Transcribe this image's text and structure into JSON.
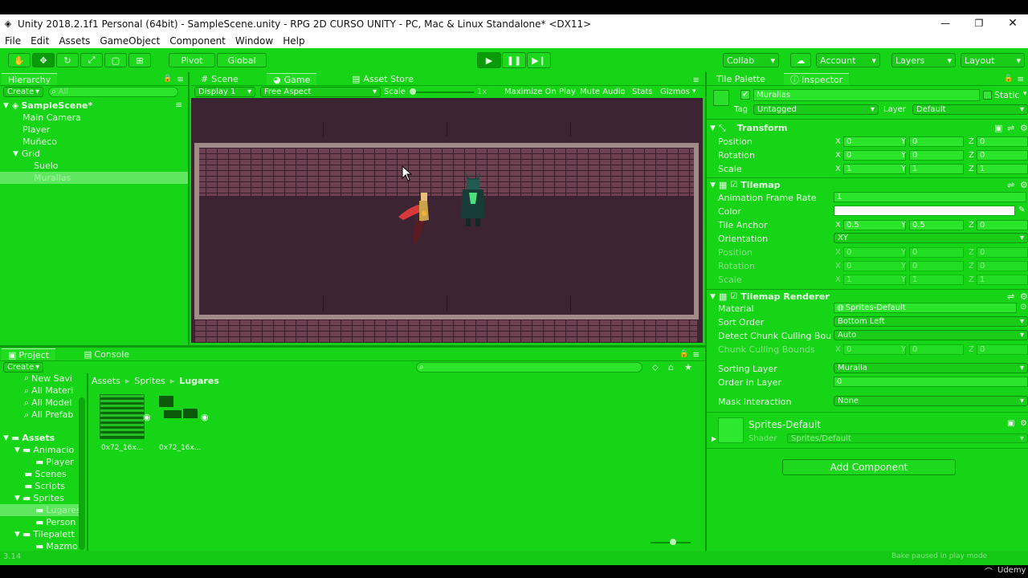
{
  "window": {
    "title": "Unity 2018.2.1f1 Personal (64bit) - SampleScene.unity - RPG 2D CURSO UNITY - PC, Mac & Linux Standalone* <DX11>"
  },
  "menu": [
    "File",
    "Edit",
    "Assets",
    "GameObject",
    "Component",
    "Window",
    "Help"
  ],
  "toolbar": {
    "pivot": "Pivot",
    "global": "Global",
    "collab": "Collab",
    "account": "Account",
    "layers": "Layers",
    "layout": "Layout"
  },
  "hierarchy": {
    "tab": "Hierarchy",
    "create": "Create",
    "search_placeholder": "All",
    "scene": "SampleScene*",
    "items": [
      "Main Camera",
      "Player",
      "Muñeco",
      "Grid",
      "Suelo",
      "Murallas"
    ]
  },
  "center_tabs": {
    "scene": "Scene",
    "game": "Game",
    "store": "Asset Store"
  },
  "game_bar": {
    "display": "Display 1",
    "aspect": "Free Aspect",
    "scale": "Scale",
    "scale_value": "1x",
    "maximize": "Maximize On Play",
    "mute": "Mute Audio",
    "stats": "Stats",
    "gizmos": "Gizmos"
  },
  "inspector": {
    "tab_palette": "Tile Palette",
    "tab": "Inspector",
    "object_name": "Murallas",
    "static": "Static",
    "tag_label": "Tag",
    "tag_value": "Untagged",
    "layer_label": "Layer",
    "layer_value": "Default",
    "transform": {
      "title": "Transform",
      "position_label": "Position",
      "position": {
        "x": "0",
        "y": "0",
        "z": "0"
      },
      "rotation_label": "Rotation",
      "rotation": {
        "x": "0",
        "y": "0",
        "z": "0"
      },
      "scale_label": "Scale",
      "scale": {
        "x": "1",
        "y": "1",
        "z": "1"
      }
    },
    "tilemap": {
      "title": "Tilemap",
      "anim_label": "Animation Frame Rate",
      "anim_value": "1",
      "color_label": "Color",
      "anchor_label": "Tile Anchor",
      "anchor": {
        "x": "0.5",
        "y": "0.5",
        "z": "0"
      },
      "orientation_label": "Orientation",
      "orientation_value": "XY",
      "o_position_label": "Position",
      "o_position": {
        "x": "0",
        "y": "0",
        "z": "0"
      },
      "o_rotation_label": "Rotation",
      "o_rotation": {
        "x": "0",
        "y": "0",
        "z": "0"
      },
      "o_scale_label": "Scale",
      "o_scale": {
        "x": "1",
        "y": "1",
        "z": "1"
      }
    },
    "renderer": {
      "title": "Tilemap Renderer",
      "material_label": "Material",
      "material_value": "Sprites-Default",
      "sort_label": "Sort Order",
      "sort_value": "Bottom Left",
      "detect_label": "Detect Chunk Culling Bour",
      "detect_value": "Auto",
      "bounds_label": "Chunk Culling Bounds",
      "bounds": {
        "x": "0",
        "y": "0",
        "z": "0"
      },
      "sorting_layer_label": "Sorting Layer",
      "sorting_layer_value": "Muralla",
      "order_label": "Order in Layer",
      "order_value": "0",
      "mask_label": "Mask Interaction",
      "mask_value": "None"
    },
    "material": {
      "name": "Sprites-Default",
      "shader_label": "Shader",
      "shader_value": "Sprites/Default"
    },
    "add_component": "Add Component",
    "axis": {
      "x": "X",
      "y": "Y",
      "z": "Z"
    }
  },
  "project": {
    "tab": "Project",
    "console_tab": "Console",
    "create": "Create",
    "favorites": [
      "New Savi",
      "All Materi",
      "All Model",
      "All Prefab"
    ],
    "assets_label": "Assets",
    "tree": [
      "Animacio",
      "Player",
      "Scenes",
      "Scripts",
      "Sprites",
      "Lugares",
      "Person",
      "Tilepalett",
      "Mazmo"
    ],
    "breadcrumb": [
      "Assets",
      "Sprites",
      "Lugares"
    ],
    "files": [
      "0x72_16x...",
      "0x72_16x..."
    ]
  },
  "status": {
    "left": "3.14",
    "right": "Bake paused in play mode",
    "brand": "Udemy"
  }
}
